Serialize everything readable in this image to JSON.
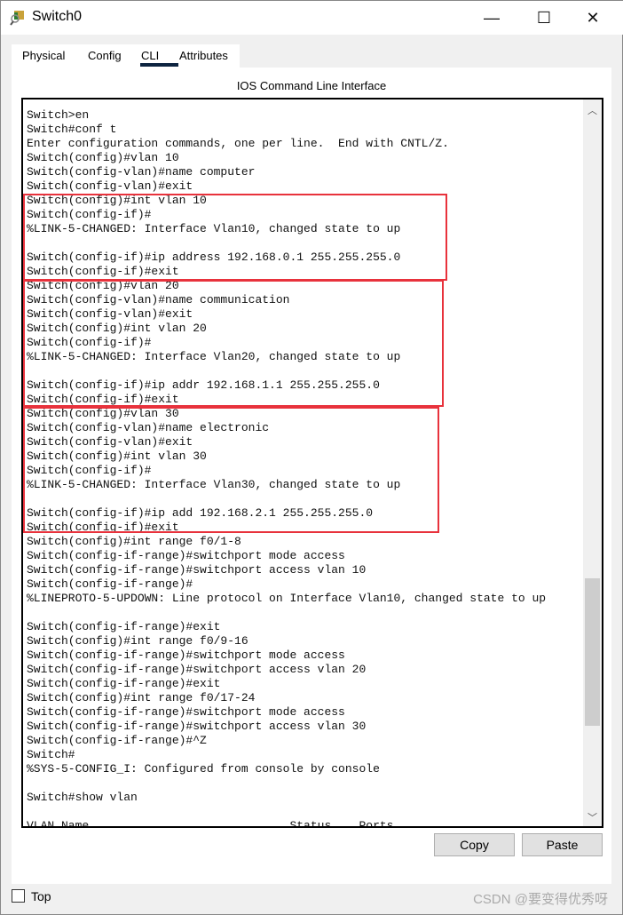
{
  "window": {
    "title": "Switch0",
    "minimize": "—",
    "maximize": "☐",
    "close": "✕",
    "icon": "switch-magnifier-icon"
  },
  "tabs": [
    {
      "label": "Physical"
    },
    {
      "label": "Config"
    },
    {
      "label": "CLI",
      "active": true
    },
    {
      "label": "Attributes"
    }
  ],
  "panel_title": "IOS Command Line Interface",
  "terminal_lines": [
    "Switch>en",
    "Switch#conf t",
    "Enter configuration commands, one per line.  End with CNTL/Z.",
    "Switch(config)#vlan 10",
    "Switch(config-vlan)#name computer",
    "Switch(config-vlan)#exit",
    "Switch(config)#int vlan 10",
    "Switch(config-if)#",
    "%LINK-5-CHANGED: Interface Vlan10, changed state to up",
    "",
    "Switch(config-if)#ip address 192.168.0.1 255.255.255.0",
    "Switch(config-if)#exit",
    "Switch(config)#vlan 20",
    "Switch(config-vlan)#name communication",
    "Switch(config-vlan)#exit",
    "Switch(config)#int vlan 20",
    "Switch(config-if)#",
    "%LINK-5-CHANGED: Interface Vlan20, changed state to up",
    "",
    "Switch(config-if)#ip addr 192.168.1.1 255.255.255.0",
    "Switch(config-if)#exit",
    "Switch(config)#vlan 30",
    "Switch(config-vlan)#name electronic",
    "Switch(config-vlan)#exit",
    "Switch(config)#int vlan 30",
    "Switch(config-if)#",
    "%LINK-5-CHANGED: Interface Vlan30, changed state to up",
    "",
    "Switch(config-if)#ip add 192.168.2.1 255.255.255.0",
    "Switch(config-if)#exit",
    "Switch(config)#int range f0/1-8",
    "Switch(config-if-range)#switchport mode access",
    "Switch(config-if-range)#switchport access vlan 10",
    "Switch(config-if-range)#",
    "%LINEPROTO-5-UPDOWN: Line protocol on Interface Vlan10, changed state to up",
    "",
    "Switch(config-if-range)#exit",
    "Switch(config)#int range f0/9-16",
    "Switch(config-if-range)#switchport mode access",
    "Switch(config-if-range)#switchport access vlan 20",
    "Switch(config-if-range)#exit",
    "Switch(config)#int range f0/17-24",
    "Switch(config-if-range)#switchport mode access",
    "Switch(config-if-range)#switchport access vlan 30",
    "Switch(config-if-range)#^Z",
    "Switch#",
    "%SYS-5-CONFIG_I: Configured from console by console",
    "",
    "Switch#show vlan",
    "",
    "VLAN Name                             Status    Ports"
  ],
  "highlight_color": "#e8323c",
  "buttons": {
    "copy": "Copy",
    "paste": "Paste"
  },
  "footer": {
    "top_label": "Top",
    "top_checked": false,
    "watermark": "CSDN @要变得优秀呀"
  },
  "scroll": {
    "up": "︿",
    "down": "﹀"
  }
}
